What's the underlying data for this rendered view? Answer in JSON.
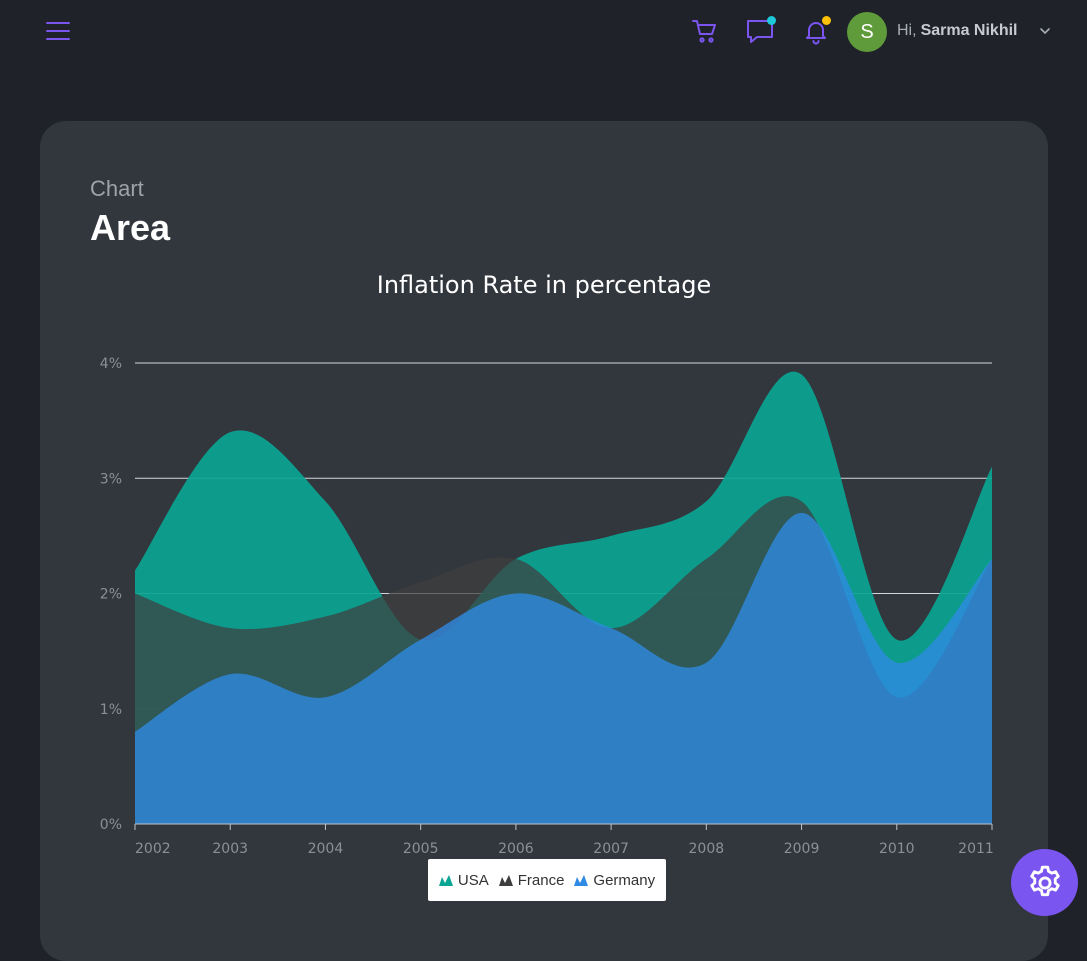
{
  "header": {
    "greeting": "Hi,",
    "user_name": "Sarma Nikhil",
    "avatar_initial": "S",
    "icons": [
      "menu-icon",
      "cart-icon",
      "chat-icon",
      "bell-icon",
      "chevron-down-icon"
    ],
    "colors": {
      "accent": "#7b55f0",
      "chat_dot": "#1ec8d8",
      "bell_dot": "#ffc107",
      "avatar": "#5f9b3a"
    }
  },
  "page": {
    "eyebrow": "Chart",
    "title": "Area"
  },
  "settings": {
    "icon": "gear-icon"
  },
  "chart_data": {
    "type": "area",
    "title": "Inflation Rate in percentage",
    "categories": [
      "2002",
      "2003",
      "2004",
      "2005",
      "2006",
      "2007",
      "2008",
      "2009",
      "2010",
      "2011"
    ],
    "ylim": [
      0,
      4
    ],
    "yticks": [
      "0%",
      "1%",
      "2%",
      "3%",
      "4%"
    ],
    "grid": true,
    "legend_position": "bottom",
    "series": [
      {
        "name": "USA",
        "color": "#0aa593",
        "values": [
          2.2,
          3.4,
          2.8,
          1.6,
          2.3,
          2.5,
          2.8,
          3.9,
          1.6,
          3.1
        ]
      },
      {
        "name": "France",
        "color": "#3e3e3e",
        "values": [
          2.0,
          1.7,
          1.8,
          2.1,
          2.3,
          1.7,
          2.3,
          2.8,
          1.1,
          2.3
        ]
      },
      {
        "name": "Germany",
        "color": "#2f8ae6",
        "values": [
          0.8,
          1.3,
          1.1,
          1.6,
          2.0,
          1.7,
          1.4,
          2.7,
          1.4,
          2.3
        ]
      }
    ]
  }
}
